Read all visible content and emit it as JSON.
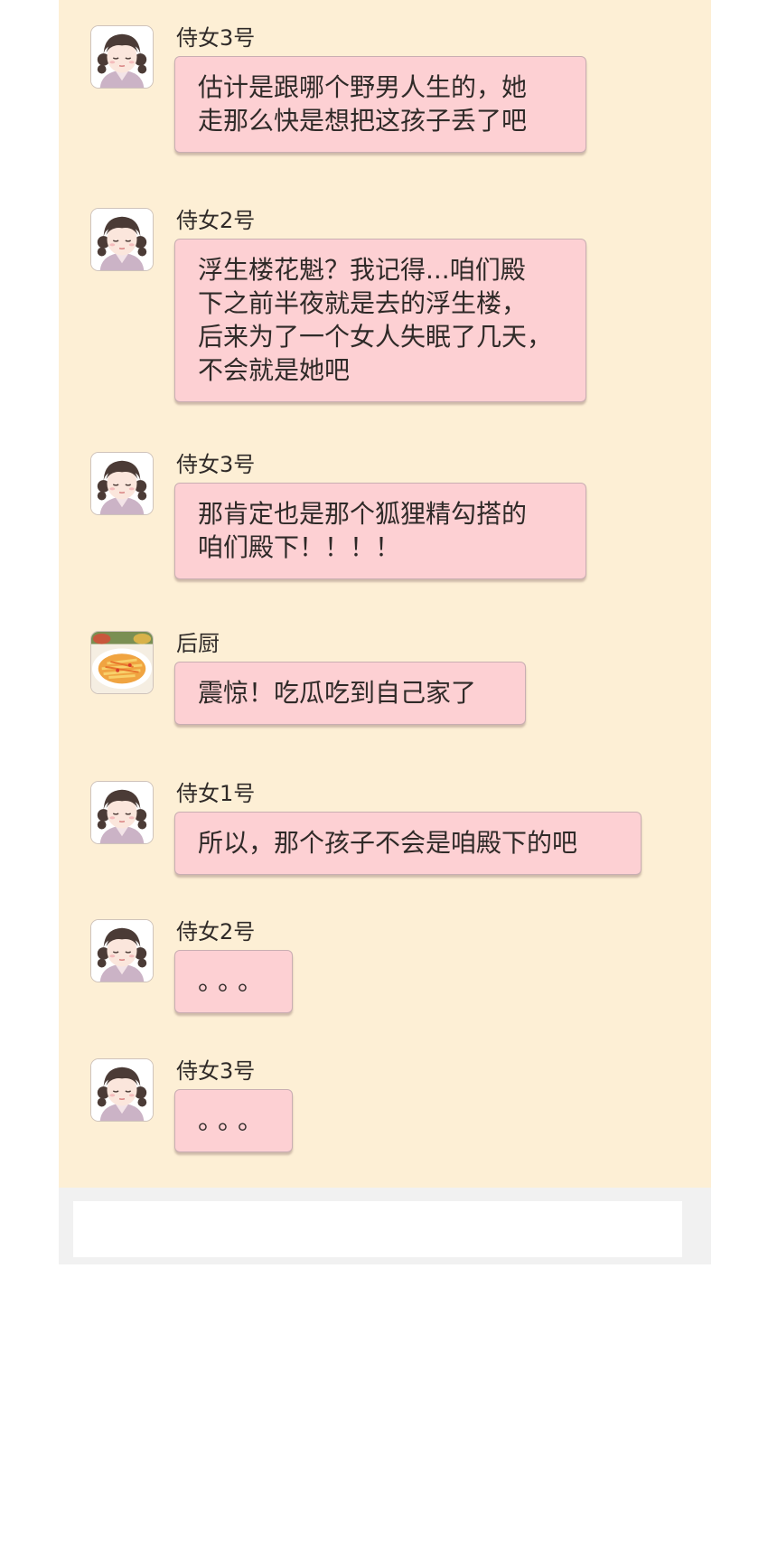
{
  "messages": [
    {
      "sender": "侍女3号",
      "text": "估计是跟哪个野男人生的，她\n走那么快是想把这孩子丢了吧",
      "avatar": "maid-avatar"
    },
    {
      "sender": "侍女2号",
      "text": "浮生楼花魁？我记得...咱们殿\n下之前半夜就是去的浮生楼，\n后来为了一个女人失眠了几天，\n不会就是她吧",
      "avatar": "maid-avatar"
    },
    {
      "sender": "侍女3号",
      "text": "那肯定也是那个狐狸精勾搭的\n咱们殿下！！！！",
      "avatar": "maid-avatar"
    },
    {
      "sender": "后厨",
      "text": "震惊！吃瓜吃到自己家了",
      "avatar": "food-dish-avatar"
    },
    {
      "sender": "侍女1号",
      "text": "所以，那个孩子不会是咱殿下的吧",
      "avatar": "maid-avatar"
    },
    {
      "sender": "侍女2号",
      "text": "。。。",
      "avatar": "maid-avatar"
    },
    {
      "sender": "侍女3号",
      "text": "。。。",
      "avatar": "maid-avatar"
    }
  ],
  "colors": {
    "panel_background": "#fdefd5",
    "bubble_background": "#fdd0d3",
    "text": "#2f2a28",
    "footer_background": "#f1f1f1"
  }
}
